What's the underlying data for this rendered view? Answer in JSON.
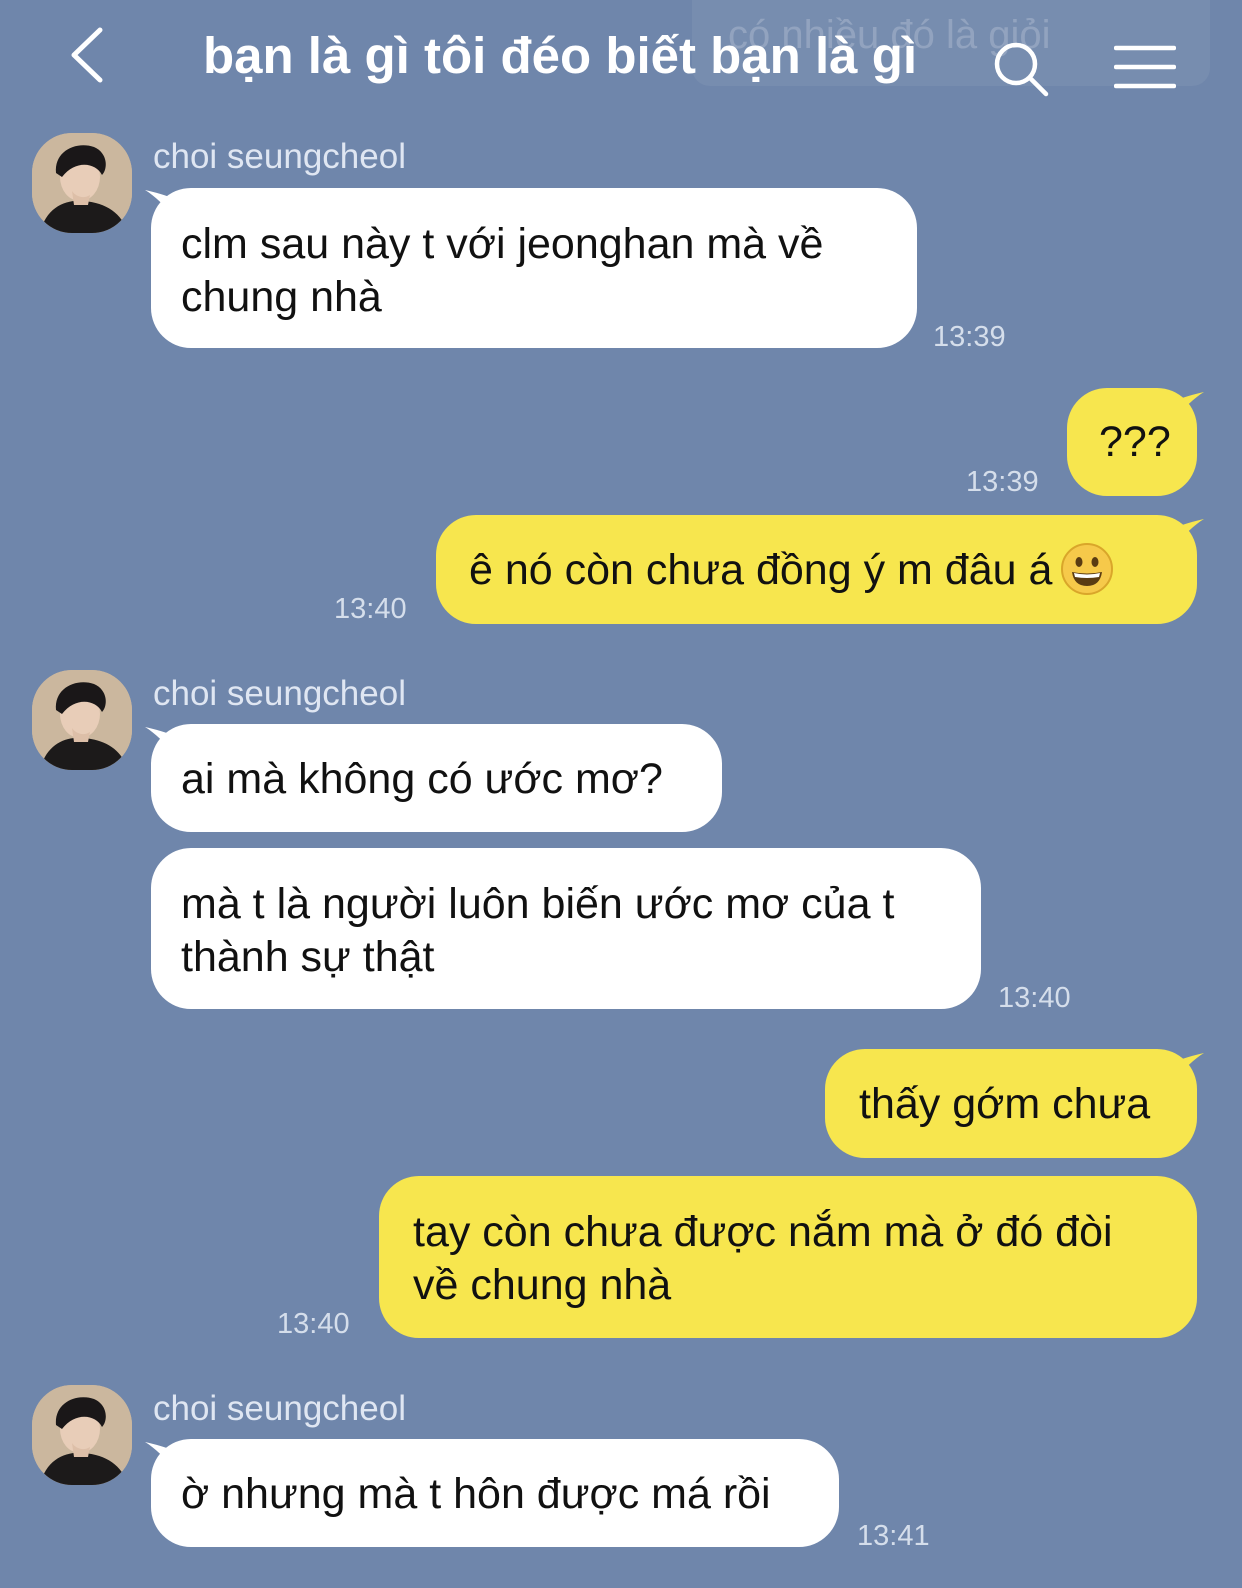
{
  "header": {
    "title": "bạn là gì tôi đéo biết bạn là gì",
    "faded_notification": "có nhiều đó là giỏi"
  },
  "messages": [
    {
      "sender": "choi seungcheol",
      "text": "clm sau này t với jeonghan mà về chung nhà",
      "time": "13:39"
    },
    {
      "text": "???",
      "time": "13:39"
    },
    {
      "text": "ê nó còn chưa đồng ý m đâu á",
      "time": "13:40"
    },
    {
      "sender": "choi seungcheol",
      "text": "ai mà không có ước mơ?"
    },
    {
      "text": "mà t là người luôn biến ước mơ của t thành sự thật",
      "time": "13:40"
    },
    {
      "text": "thấy gớm chưa"
    },
    {
      "text": "tay còn chưa được nắm mà ở đó đòi về chung nhà",
      "time": "13:40"
    },
    {
      "sender": "choi seungcheol",
      "text": "ờ nhưng mà t hôn được má rồi",
      "time": "13:41"
    }
  ],
  "colors": {
    "background": "#6f86ab",
    "incoming_bubble": "#ffffff",
    "outgoing_bubble": "#f7e64e"
  }
}
